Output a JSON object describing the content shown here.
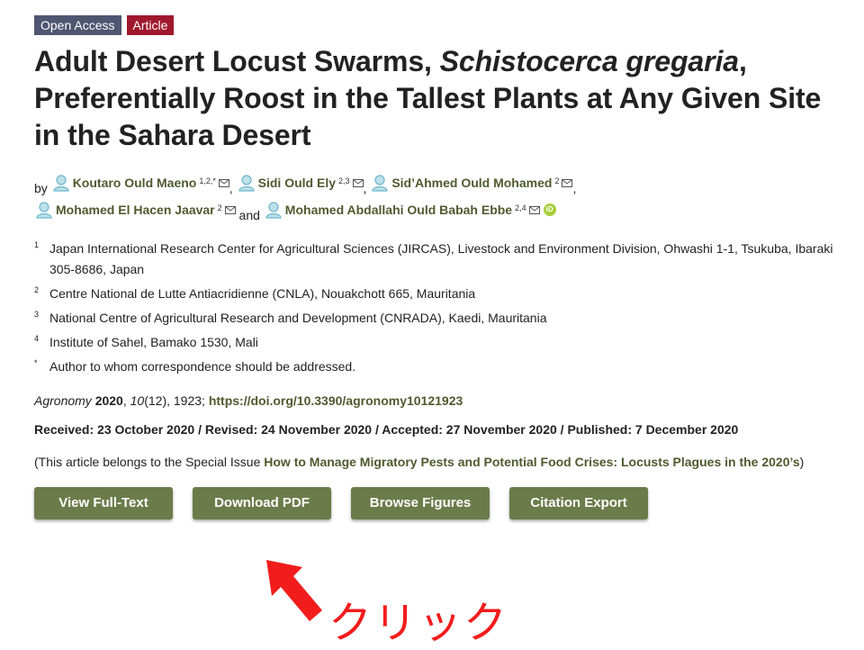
{
  "badges": {
    "open_access": "Open Access",
    "article": "Article"
  },
  "title": {
    "part1": "Adult Desert Locust Swarms, ",
    "italic": "Schistocerca gregaria",
    "part2": ", Preferentially Roost in the Tallest Plants at Any Given Site in the Sahara Desert"
  },
  "authors": {
    "by": "by",
    "and": "and",
    "list": [
      {
        "name": "Koutaro Ould Maeno",
        "sup": "1,2,*"
      },
      {
        "name": "Sidi Ould Ely",
        "sup": "2,3"
      },
      {
        "name": "Sid’Ahmed Ould Mohamed",
        "sup": "2"
      },
      {
        "name": "Mohamed El Hacen Jaavar",
        "sup": "2"
      },
      {
        "name": "Mohamed Abdallahi Ould Babah Ebbe",
        "sup": "2,4"
      }
    ],
    "orcid": "iD"
  },
  "affiliations": [
    {
      "num": "1",
      "text": "Japan International Research Center for Agricultural Sciences (JIRCAS), Livestock and Environment Division, Ohwashi 1-1, Tsukuba, Ibaraki 305-8686, Japan"
    },
    {
      "num": "2",
      "text": "Centre National de Lutte Antiacridienne (CNLA), Nouakchott 665, Mauritania"
    },
    {
      "num": "3",
      "text": "National Centre of Agricultural Research and Development (CNRADA), Kaedi, Mauritania"
    },
    {
      "num": "4",
      "text": "Institute of Sahel, Bamako 1530, Mali"
    },
    {
      "num": "*",
      "text": "Author to whom correspondence should be addressed."
    }
  ],
  "journal": {
    "name": "Agronomy",
    "year": "2020",
    "volume": "10",
    "issue_pages": "(12), 1923; ",
    "doi": "https://doi.org/10.3390/agronomy10121923"
  },
  "dates": "Received: 23 October 2020 / Revised: 24 November 2020 / Accepted: 27 November 2020 / Published: 7 December 2020",
  "special_issue": {
    "prefix": "(This article belongs to the Special Issue ",
    "link": "How to Manage Migratory Pests and Potential Food Crises: Locusts Plagues in the 2020’s",
    "suffix": ")"
  },
  "buttons": {
    "view_full_text": "View Full-Text",
    "download_pdf": "Download PDF",
    "browse_figures": "Browse Figures",
    "citation_export": "Citation Export"
  },
  "annotation": {
    "label": "クリック",
    "color": "#f21c1c"
  },
  "colors": {
    "accent": "#6b7c4a",
    "link": "#4f5a2f",
    "badge_oa": "#4f5671",
    "badge_article": "#a0182d"
  }
}
